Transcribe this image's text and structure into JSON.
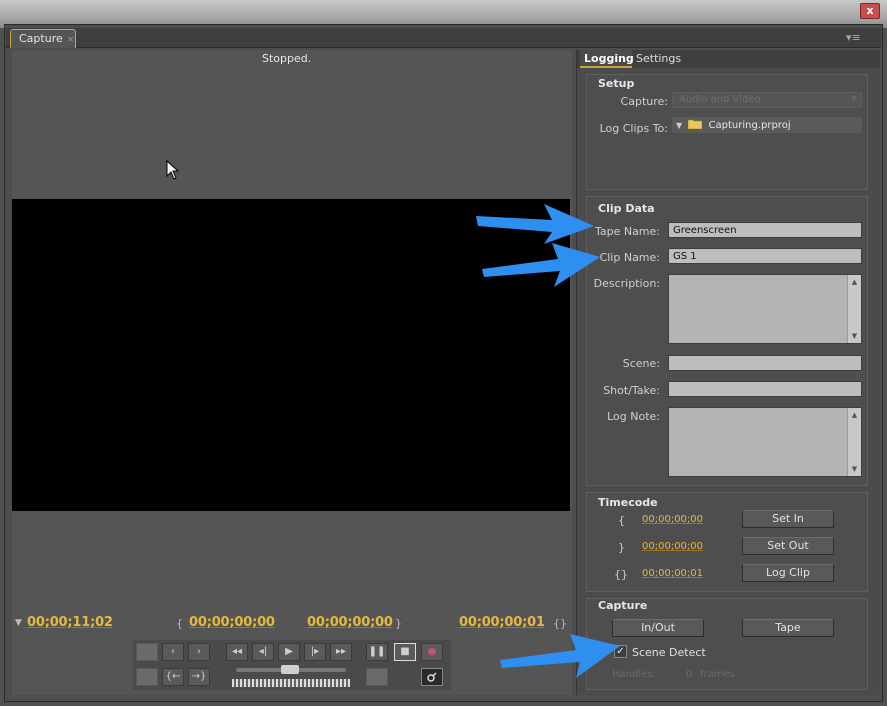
{
  "window": {
    "close_glyph": "x"
  },
  "panel": {
    "tab_label": "Capture",
    "tab_close": "×",
    "menu_glyph": "▾≡"
  },
  "monitor": {
    "status": "Stopped.",
    "current_tc": "00;00;11;02",
    "in_tc": "00;00;00;00",
    "out_tc": "00;00;00;00",
    "duration_tc": "00;00;00;01"
  },
  "transport": {
    "prev": "‹",
    "next": "›",
    "rewind": "◂◂",
    "step_back": "◂|",
    "play": "▶",
    "step_fwd": "|▸",
    "ffwd": "▸▸",
    "goto_in": "{←",
    "goto_out": "→}",
    "pause": "❚❚",
    "stop": "■",
    "record": "●"
  },
  "tabs": {
    "logging": "Logging",
    "settings": "Settings"
  },
  "setup": {
    "title": "Setup",
    "capture_label": "Capture:",
    "capture_value": "Audio and Video",
    "log_clips_label": "Log Clips To:",
    "log_clips_value": "Capturing.prproj"
  },
  "clip_data": {
    "title": "Clip Data",
    "tape_name_label": "Tape Name:",
    "tape_name_value": "Greenscreen",
    "clip_name_label": "Clip Name:",
    "clip_name_value": "GS 1",
    "description_label": "Description:",
    "scene_label": "Scene:",
    "shot_take_label": "Shot/Take:",
    "log_note_label": "Log Note:"
  },
  "timecode": {
    "title": "Timecode",
    "in_glyph": "{",
    "out_glyph": "}",
    "dur_glyph": "{}",
    "in_value": "00;00;00;00",
    "out_value": "00;00;00;00",
    "dur_value": "00;00;00;01",
    "set_in": "Set In",
    "set_out": "Set Out",
    "log_clip": "Log Clip"
  },
  "capture": {
    "title": "Capture",
    "in_out_button": "In/Out",
    "tape_button": "Tape",
    "scene_detect_label": "Scene Detect",
    "handles_label": "Handles:",
    "handles_value": "0",
    "handles_unit": "frames"
  },
  "colors": {
    "accent": "#e7b93a",
    "arrow": "#2f8ff0"
  }
}
